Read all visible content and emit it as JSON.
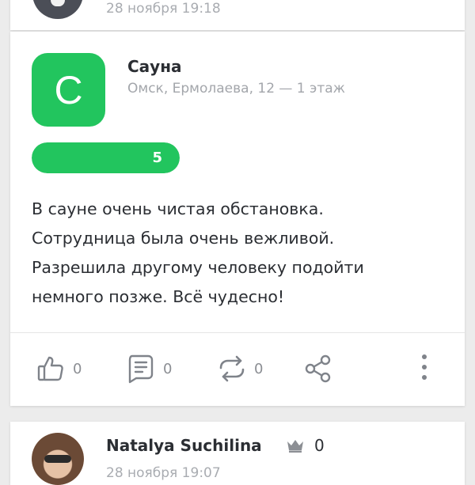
{
  "previous_review": {
    "date": "28 ноября 19:18"
  },
  "review": {
    "place": {
      "logo_letter": "С",
      "name": "Сауна",
      "address": "Омск, Ермолаева, 12 — 1 этаж"
    },
    "rating": {
      "value": "5",
      "fill_fraction": 1.0,
      "color": "#22c55e"
    },
    "text": "В сауне очень чистая обстановка.\nСотрудница была очень вежливой.\nРазрешила другому человеку подойти\nнемного позже. Всё чудесно!",
    "actions": {
      "likes": "0",
      "comments": "0",
      "reposts": "0"
    },
    "icons": [
      "thumbs-up-icon",
      "comment-icon",
      "repost-icon",
      "share-icon",
      "more-vertical-icon"
    ]
  },
  "next_review": {
    "user_name": "Natalya Suchilina",
    "user_score": "0",
    "date": "28 ноября 19:07"
  }
}
